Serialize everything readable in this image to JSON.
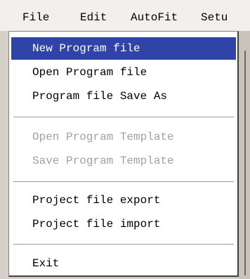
{
  "menubar": {
    "items": [
      "File",
      "Edit",
      "AutoFit",
      "Setu"
    ]
  },
  "file_menu": {
    "new_program_file": "New Program file",
    "open_program_file": "Open Program file",
    "program_file_save_as": "Program file Save As",
    "open_program_template": "Open Program Template",
    "save_program_template": "Save Program Template",
    "project_file_export": "Project file export",
    "project_file_import": "Project file import",
    "exit": "Exit"
  },
  "colors": {
    "highlight": "#2f43a8",
    "disabled_text": "#a0a0a0"
  }
}
